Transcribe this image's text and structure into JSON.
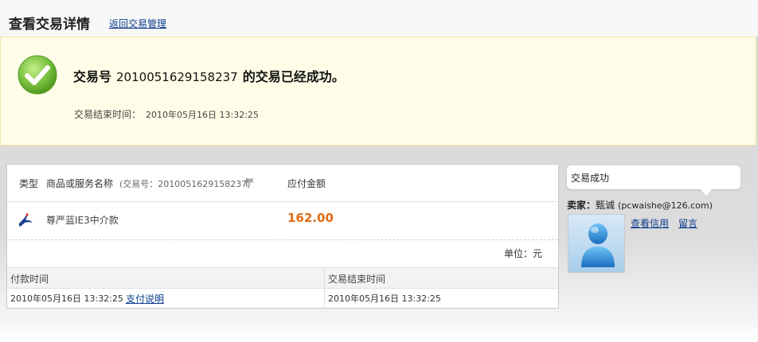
{
  "header": {
    "title": "查看交易详情",
    "back_link": "返回交易管理"
  },
  "success": {
    "prefix": "交易号",
    "trade_no": "2010051629158237",
    "suffix": "的交易已经成功。",
    "end_time_label": "交易结束时间：",
    "end_time_value": "2010年05月16日 13:32:25",
    "accent_color": "#7cc242"
  },
  "detail": {
    "col_type": "类型",
    "col_name": "商品或服务名称",
    "trade_no_text": "(交易号：2010051629158237)",
    "col_amount": "应付金额",
    "item": {
      "name": "尊严蓝IE3中介款",
      "amount": "162.00",
      "icon": "swallow-icon"
    },
    "unit": "单位：元",
    "pay_time_header": "付款时间",
    "end_time_header": "交易结束时间",
    "pay_time_value": "2010年05月16日 13:32:25",
    "pay_explain_link": "支付说明",
    "end_time_value": "2010年05月16日 13:32:25",
    "amount_color": "#e06a12"
  },
  "sidebar": {
    "status": "交易成功",
    "seller_label": "卖家：",
    "seller_name": "甄诚",
    "seller_email": "(pcwaishe@126.com)",
    "link_credit": "查看信用",
    "link_message": "留言"
  }
}
